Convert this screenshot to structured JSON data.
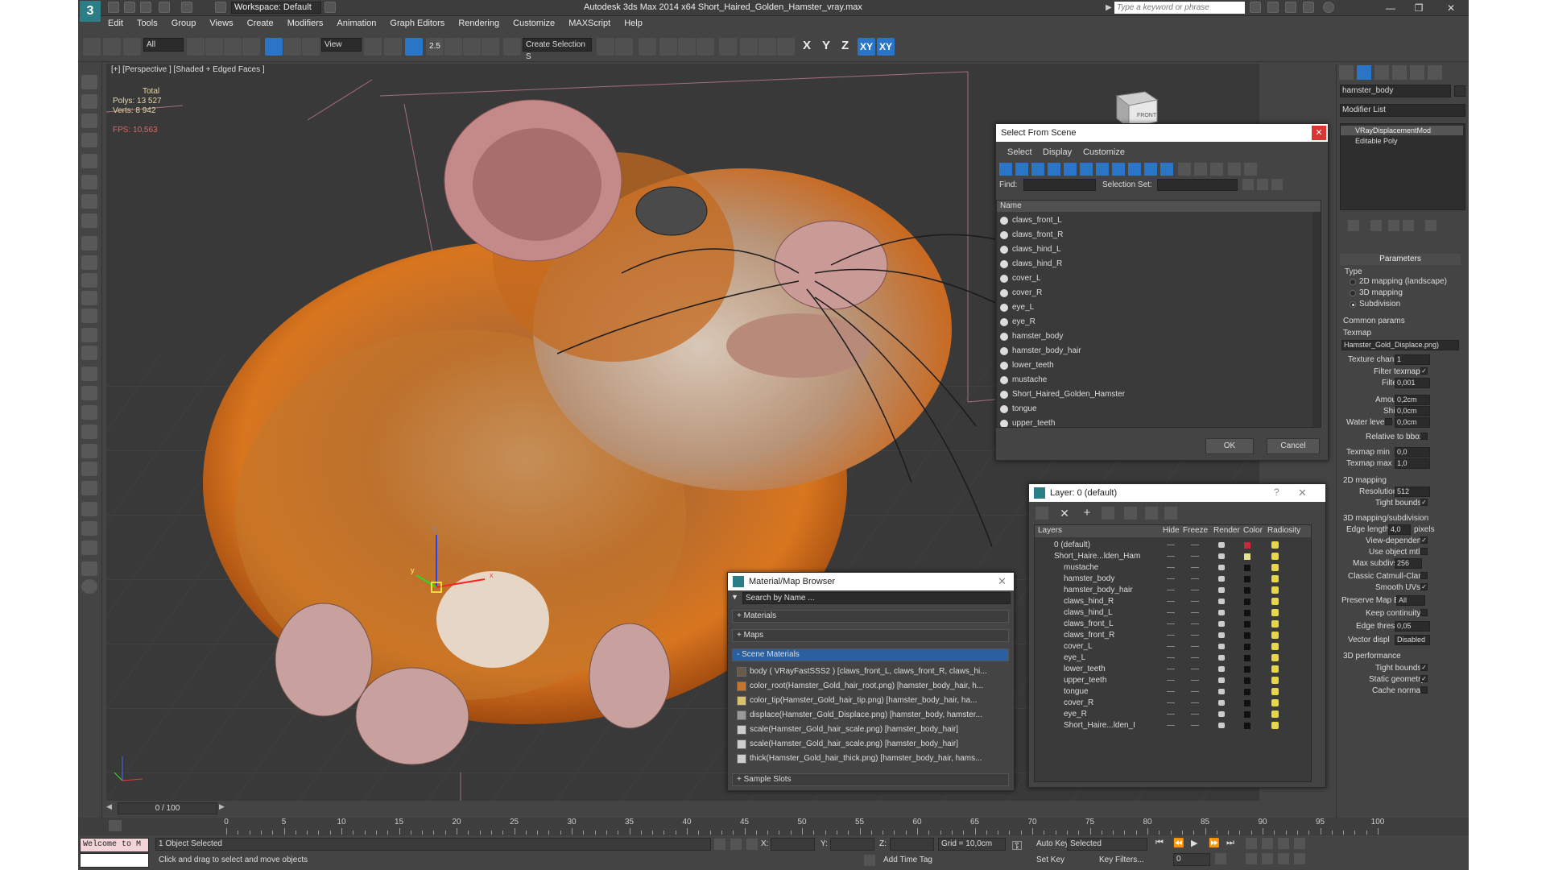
{
  "window": {
    "title": "Autodesk 3ds Max  2014 x64      Short_Haired_Golden_Hamster_vray.max",
    "workspace": "Workspace: Default",
    "search_placeholder": "Type a keyword or phrase"
  },
  "menu": [
    "Edit",
    "Tools",
    "Group",
    "Views",
    "Create",
    "Modifiers",
    "Animation",
    "Graph Editors",
    "Rendering",
    "Customize",
    "MAXScript",
    "Help"
  ],
  "toolbar": {
    "filter_select": "All",
    "refcoord_select": "View",
    "named_selection": "Create Selection S",
    "snap_label": "2.5",
    "axes": [
      "X",
      "Y",
      "Z",
      "XY",
      "XY"
    ]
  },
  "viewport": {
    "label": "[+] [Perspective ] [Shaded + Edged Faces ]",
    "stats_header": "Total",
    "polys_label": "Polys:",
    "polys_value": "13 527",
    "verts_label": "Verts:",
    "verts_value": "8 942",
    "fps_label": "FPS:",
    "fps_value": "10,563",
    "gizmo_x": "x",
    "gizmo_y": "y",
    "gizmo_z": "z",
    "viewcube_label": "FRONT"
  },
  "select_from_scene": {
    "title": "Select From Scene",
    "menu": [
      "Select",
      "Display",
      "Customize"
    ],
    "find_label": "Find:",
    "selection_set_label": "Selection Set:",
    "column_name": "Name",
    "items": [
      "claws_front_L",
      "claws_front_R",
      "claws_hind_L",
      "claws_hind_R",
      "cover_L",
      "cover_R",
      "eye_L",
      "eye_R",
      "hamster_body",
      "hamster_body_hair",
      "lower_teeth",
      "mustache",
      "Short_Haired_Golden_Hamster",
      "tongue",
      "upper_teeth"
    ],
    "ok": "OK",
    "cancel": "Cancel"
  },
  "layer_dialog": {
    "title": "Layer: 0 (default)",
    "help": "?",
    "columns": [
      "Layers",
      "Hide",
      "Freeze",
      "Render",
      "Color",
      "Radiosity"
    ],
    "rows": [
      {
        "name": "0 (default)",
        "color": "#c8283c",
        "indent": 1
      },
      {
        "name": "Short_Haire...lden_Ham",
        "color": "#e8e08c",
        "indent": 1
      },
      {
        "name": "mustache",
        "color": "#111111",
        "indent": 2
      },
      {
        "name": "hamster_body",
        "color": "#111111",
        "indent": 2
      },
      {
        "name": "hamster_body_hair",
        "color": "#111111",
        "indent": 2
      },
      {
        "name": "claws_hind_R",
        "color": "#111111",
        "indent": 2
      },
      {
        "name": "claws_hind_L",
        "color": "#111111",
        "indent": 2
      },
      {
        "name": "claws_front_L",
        "color": "#111111",
        "indent": 2
      },
      {
        "name": "claws_front_R",
        "color": "#111111",
        "indent": 2
      },
      {
        "name": "cover_L",
        "color": "#111111",
        "indent": 2
      },
      {
        "name": "eye_L",
        "color": "#111111",
        "indent": 2
      },
      {
        "name": "lower_teeth",
        "color": "#111111",
        "indent": 2
      },
      {
        "name": "upper_teeth",
        "color": "#111111",
        "indent": 2
      },
      {
        "name": "tongue",
        "color": "#111111",
        "indent": 2
      },
      {
        "name": "cover_R",
        "color": "#111111",
        "indent": 2
      },
      {
        "name": "eye_R",
        "color": "#111111",
        "indent": 2
      },
      {
        "name": "Short_Haire...lden_I",
        "color": "#111111",
        "indent": 2
      }
    ]
  },
  "material_browser": {
    "title": "Material/Map Browser",
    "search_placeholder": "Search by Name ...",
    "sections": [
      "+ Materials",
      "+ Maps",
      "- Scene Materials",
      "+ Sample Slots"
    ],
    "items": [
      "body  ( VRayFastSSS2 )  [claws_front_L, claws_front_R, claws_hi...",
      "color_root(Hamster_Gold_hair_root.png) [hamster_body_hair, h...",
      "color_tip(Hamster_Gold_hair_tip.png) [hamster_body_hair, ha...",
      "displace(Hamster_Gold_Displace.png) [hamster_body, hamster...",
      "scale(Hamster_Gold_hair_scale.png) [hamster_body_hair]",
      "scale(Hamster_Gold_hair_scale.png) [hamster_body_hair]",
      "thick(Hamster_Gold_hair_thick.png) [hamster_body_hair, hams..."
    ]
  },
  "command_panel": {
    "object_name": "hamster_body",
    "modifier_list": "Modifier List",
    "stack": [
      "VRayDisplacementMod",
      "Editable Poly"
    ],
    "parameters_header": "Parameters",
    "type_label": "Type",
    "type_options": [
      "2D mapping (landscape)",
      "3D mapping",
      "Subdivision"
    ],
    "common_params": "Common params",
    "texmap_label": "Texmap",
    "texmap_value": "Hamster_Gold_Displace.png)",
    "texture_chan_label": "Texture chan",
    "texture_chan_value": "1",
    "filter_texmap_label": "Filter texmap",
    "filter_blur_label": "Filter blur",
    "filter_blur_value": "0,001",
    "amount_label": "Amount",
    "amount_value": "0,2cm",
    "shift_label": "Shift",
    "shift_value": "0,0cm",
    "water_level_label": "Water level",
    "water_level_value": "0,0cm",
    "relative_bbox_label": "Relative to bbox",
    "texmap_min_label": "Texmap min",
    "texmap_min_value": "0,0",
    "texmap_max_label": "Texmap max",
    "texmap_max_value": "1,0",
    "mapping2d_label": "2D mapping",
    "resolution_label": "Resolution",
    "resolution_value": "512",
    "tight_bounds_label": "Tight bounds",
    "mapping3d_label": "3D mapping/subdivision",
    "edge_length_label": "Edge length",
    "edge_length_value": "4,0",
    "pixels_label": "pixels",
    "view_dependent_label": "View-dependent",
    "use_object_mtl_label": "Use object mtl",
    "max_subdivs_label": "Max subdivs",
    "max_subdivs_value": "256",
    "catmull_label": "Classic Catmull-Clark",
    "smooth_uvs_label": "Smooth UVs",
    "preserve_map_label": "Preserve Map Bnd",
    "preserve_map_value": "All",
    "keep_continuity_label": "Keep continuity",
    "edge_thresh_label": "Edge thresh",
    "edge_thresh_value": "0,05",
    "vector_disp_label": "Vector displ",
    "vector_disp_value": "Disabled",
    "performance_label": "3D performance",
    "perf_tight_bounds": "Tight bounds",
    "static_geometry_label": "Static geometry",
    "cache_normals_label": "Cache normals"
  },
  "timeline": {
    "frame": "0 / 100",
    "ticks": [
      "0",
      "5",
      "10",
      "15",
      "20",
      "25",
      "30",
      "35",
      "40",
      "45",
      "50",
      "55",
      "60",
      "65",
      "70",
      "75",
      "80",
      "85",
      "90",
      "95",
      "100"
    ]
  },
  "status": {
    "maxscript": "Welcome to M",
    "selected": "1 Object Selected",
    "prompt": "Click and drag to select and move objects",
    "x_label": "X:",
    "y_label": "Y:",
    "z_label": "Z:",
    "grid": "Grid = 10,0cm",
    "add_time_tag": "Add Time Tag",
    "auto_key": "Auto Key",
    "set_key": "Set Key",
    "selected_dropdown": "Selected",
    "key_filters": "Key Filters...",
    "frame_value": "0"
  }
}
